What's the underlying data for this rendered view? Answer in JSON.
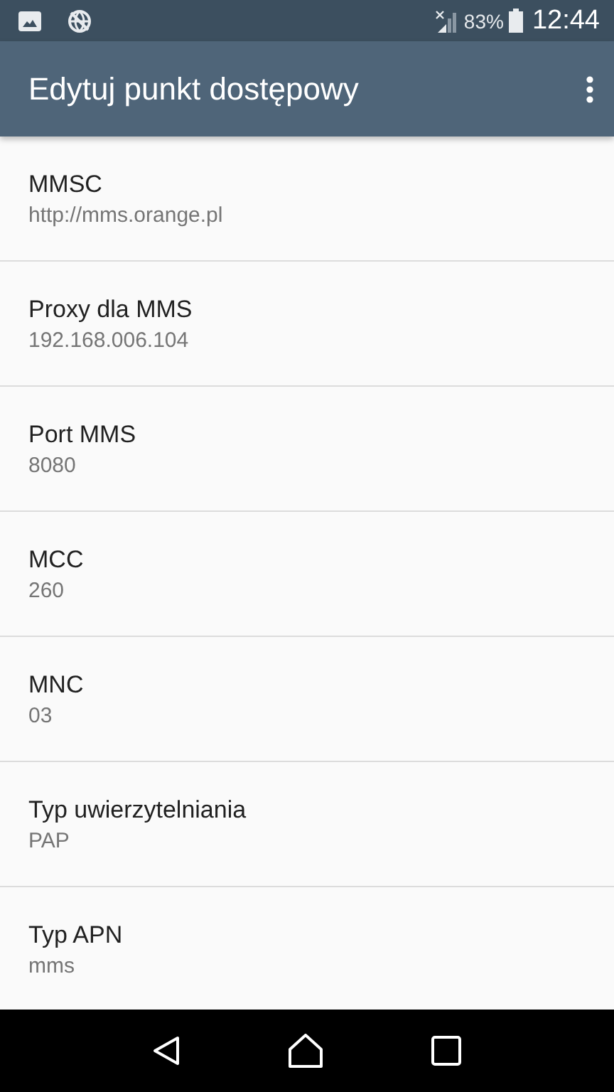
{
  "status_bar": {
    "battery": "83%",
    "time": "12:44"
  },
  "app_bar": {
    "title": "Edytuj punkt dostępowy"
  },
  "settings": [
    {
      "label": "MMSC",
      "value": "http://mms.orange.pl"
    },
    {
      "label": "Proxy dla MMS",
      "value": "192.168.006.104"
    },
    {
      "label": "Port MMS",
      "value": "8080"
    },
    {
      "label": "MCC",
      "value": "260"
    },
    {
      "label": "MNC",
      "value": "03"
    },
    {
      "label": "Typ uwierzytelniania",
      "value": "PAP"
    },
    {
      "label": "Typ APN",
      "value": "mms"
    }
  ]
}
